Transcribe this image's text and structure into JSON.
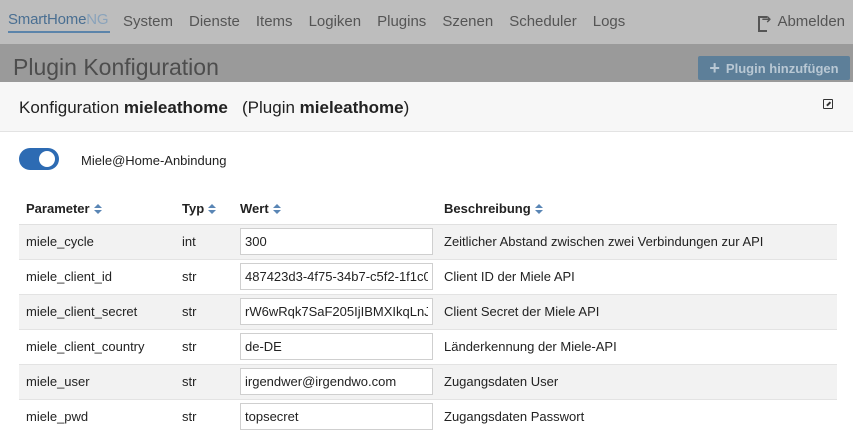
{
  "navbar": {
    "brand_main": "SmartHome",
    "brand_ng": "NG",
    "items": [
      "System",
      "Dienste",
      "Items",
      "Logiken",
      "Plugins",
      "Szenen",
      "Scheduler",
      "Logs"
    ],
    "logout_label": "Abmelden"
  },
  "page": {
    "title": "Plugin Konfiguration",
    "add_button_label": "Plugin hinzufügen"
  },
  "modal": {
    "title_prefix": "Konfiguration ",
    "title_name": "mieleathome",
    "title_plugin_prefix": "(Plugin ",
    "title_plugin_name": "mieleathome",
    "title_plugin_suffix": ")",
    "toggle_label": "Miele@Home-Anbindung",
    "toggle_on": true
  },
  "table": {
    "headers": [
      "Parameter",
      "Typ",
      "Wert",
      "Beschreibung"
    ],
    "rows": [
      {
        "param": "miele_cycle",
        "type": "int",
        "value": "300",
        "desc": "Zeitlicher Abstand zwischen zwei Verbindungen zur API"
      },
      {
        "param": "miele_client_id",
        "type": "str",
        "value": "487423d3-4f75-34b7-c5f2-1f1c0",
        "desc": "Client ID der Miele API"
      },
      {
        "param": "miele_client_secret",
        "type": "str",
        "value": "rW6wRqk7SaF205IjIBMXIkqLnJ",
        "desc": "Client Secret der Miele API"
      },
      {
        "param": "miele_client_country",
        "type": "str",
        "value": "de-DE",
        "desc": "Länderkennung der Miele-API"
      },
      {
        "param": "miele_user",
        "type": "str",
        "value": "irgendwer@irgendwo.com",
        "desc": "Zugangsdaten User"
      },
      {
        "param": "miele_pwd",
        "type": "str",
        "value": "topsecret",
        "desc": "Zugangsdaten Passwort"
      }
    ]
  }
}
